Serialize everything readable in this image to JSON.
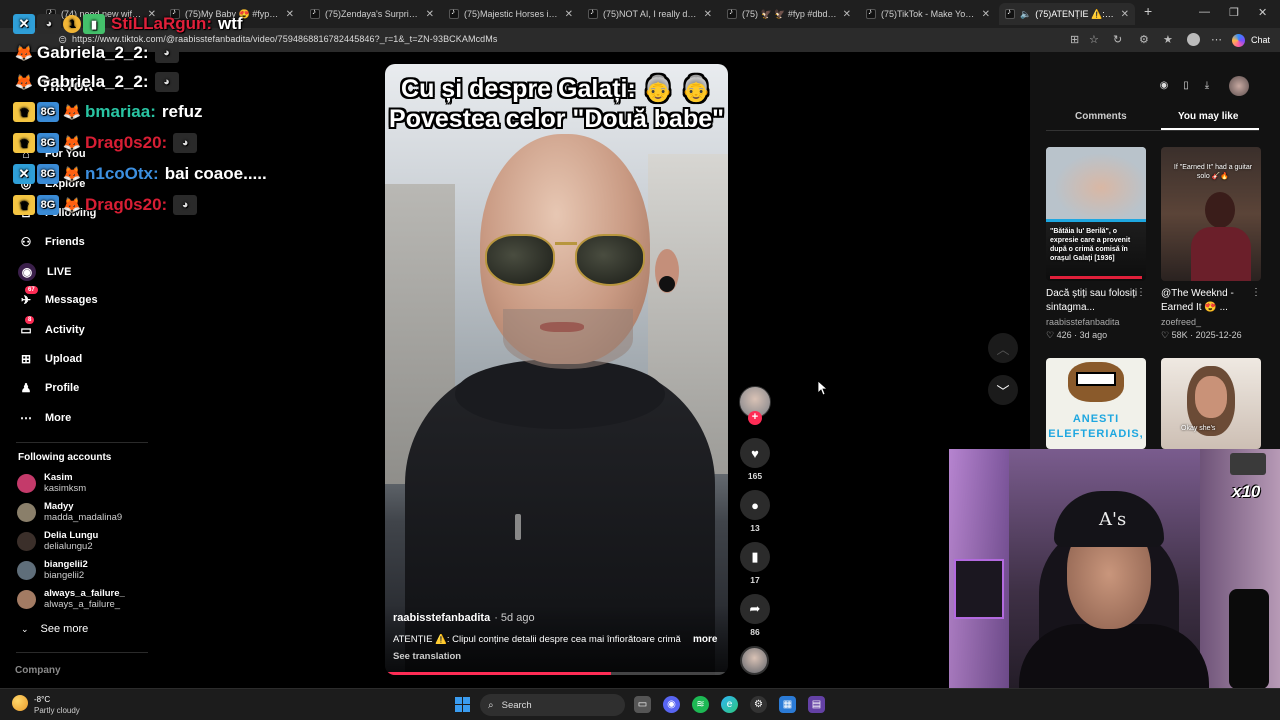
{
  "browser": {
    "tabs": [
      {
        "title": "(74) need new wifi. #dbd"
      },
      {
        "title": "(75)My Baby 😍 #fyp #supe"
      },
      {
        "title": "(75)Zendaya's Surprise Reun"
      },
      {
        "title": "(75)Majestic Horses in Natu"
      },
      {
        "title": "(75)NOT AI, I really did THAT"
      },
      {
        "title": "(75) 🦅 🦅 #fyp #dbdvide"
      },
      {
        "title": "(75)TikTok - Make Your Day"
      },
      {
        "title": "(75)ATENȚIE ⚠️: Clipul c"
      }
    ],
    "new_tab": "+",
    "url": "https://www.tiktok.com/@raabisstefanbadita/video/7594868816782445846?_r=1&_t=ZN-93BCKAMcdMs",
    "chat_label": "Chat"
  },
  "sidebar": {
    "logo": "TikTok",
    "items": [
      {
        "label": "For You",
        "icon": "home-icon"
      },
      {
        "label": "Explore",
        "icon": "compass-icon"
      },
      {
        "label": "Following",
        "icon": "following-icon"
      },
      {
        "label": "Friends",
        "icon": "friends-icon"
      },
      {
        "label": "LIVE",
        "icon": "live-icon"
      },
      {
        "label": "Messages",
        "icon": "messages-icon",
        "badge": "67"
      },
      {
        "label": "Activity",
        "icon": "activity-icon",
        "badge": "8"
      },
      {
        "label": "Upload",
        "icon": "upload-icon"
      },
      {
        "label": "Profile",
        "icon": "profile-icon"
      },
      {
        "label": "More",
        "icon": "more-icon"
      }
    ],
    "following_title": "Following accounts",
    "following": [
      {
        "name": "Kasim",
        "handle": "kasimksm",
        "color": "#c43a6a"
      },
      {
        "name": "Madyy",
        "handle": "madda_madalina9",
        "color": "#8a7f6a"
      },
      {
        "name": "Delia Lungu",
        "handle": "delialungu2",
        "color": "#3b2f2a"
      },
      {
        "name": "biangelii2",
        "handle": "biangelii2",
        "color": "#5f6e7a"
      },
      {
        "name": "always_a_failure_",
        "handle": "always_a_failure_",
        "color": "#a37b63"
      }
    ],
    "see_more": "See more",
    "company": "Company"
  },
  "chat_overlay": [
    {
      "user": "StiLLaRgun:",
      "message": "wtf",
      "user_color": "#e0203a"
    },
    {
      "user": "Gabriela_2_2:",
      "message": "",
      "user_color": "#ffffff"
    },
    {
      "user": "Gabriela_2_2:",
      "message": "",
      "user_color": "#ffffff"
    },
    {
      "user": "bmariaa:",
      "message": "refuz",
      "user_color": "#29c4a3"
    },
    {
      "user": "Drag0s20:",
      "message": "",
      "user_color": "#d81e34"
    },
    {
      "user": "n1coOtx:",
      "message": "bai coaoe.....",
      "user_color": "#3c8fe0"
    },
    {
      "user": "Drag0s20:",
      "message": "",
      "user_color": "#d81e34"
    }
  ],
  "video": {
    "caption_line1": "Cu și despre Galați: 👵 👵",
    "caption_line2": "Povestea celor \"Două babe\"",
    "author": "raabisstefanbadita",
    "age": "· 5d ago",
    "description": "ATENȚIE ⚠️: Clipul conține detalii despre cea mai înfiorătoare crimă",
    "more": "more",
    "see_translation": "See translation",
    "progress": 0.66
  },
  "actions": {
    "likes": "165",
    "comments": "13",
    "saves": "17",
    "shares": "86"
  },
  "right_panel": {
    "tabs": [
      "Comments",
      "You may like"
    ],
    "active_tab": "You may like",
    "cards": [
      {
        "title": "Dacă știți sau folosiți sintagma...",
        "author": "raabisstefanbadita",
        "likes": "426",
        "date": "3d ago",
        "thumb_text": "\"Bătăia lu' Berilă\", o expresie care a provenit după o crimă comisă în orașul Galați [1936]"
      },
      {
        "title": "@The Weeknd - Earned It 😍 ...",
        "author": "zoefreed_",
        "likes": "58K",
        "date": "2025-12-26",
        "thumb_text": "If \"Earned It\" had a guitar solo 🎸🔥"
      },
      {
        "title": "",
        "author": "",
        "likes": "",
        "date": "",
        "thumb_text": "ANESTI ELEFTERIADIS,"
      },
      {
        "title": "",
        "author": "",
        "likes": "",
        "date": "",
        "thumb_text": "Okay she's"
      }
    ]
  },
  "webcam": {
    "cap_logo": "A's",
    "multiplier": "x10"
  },
  "taskbar": {
    "temperature": "-8°C",
    "weather": "Partly cloudy",
    "search": "Search"
  }
}
